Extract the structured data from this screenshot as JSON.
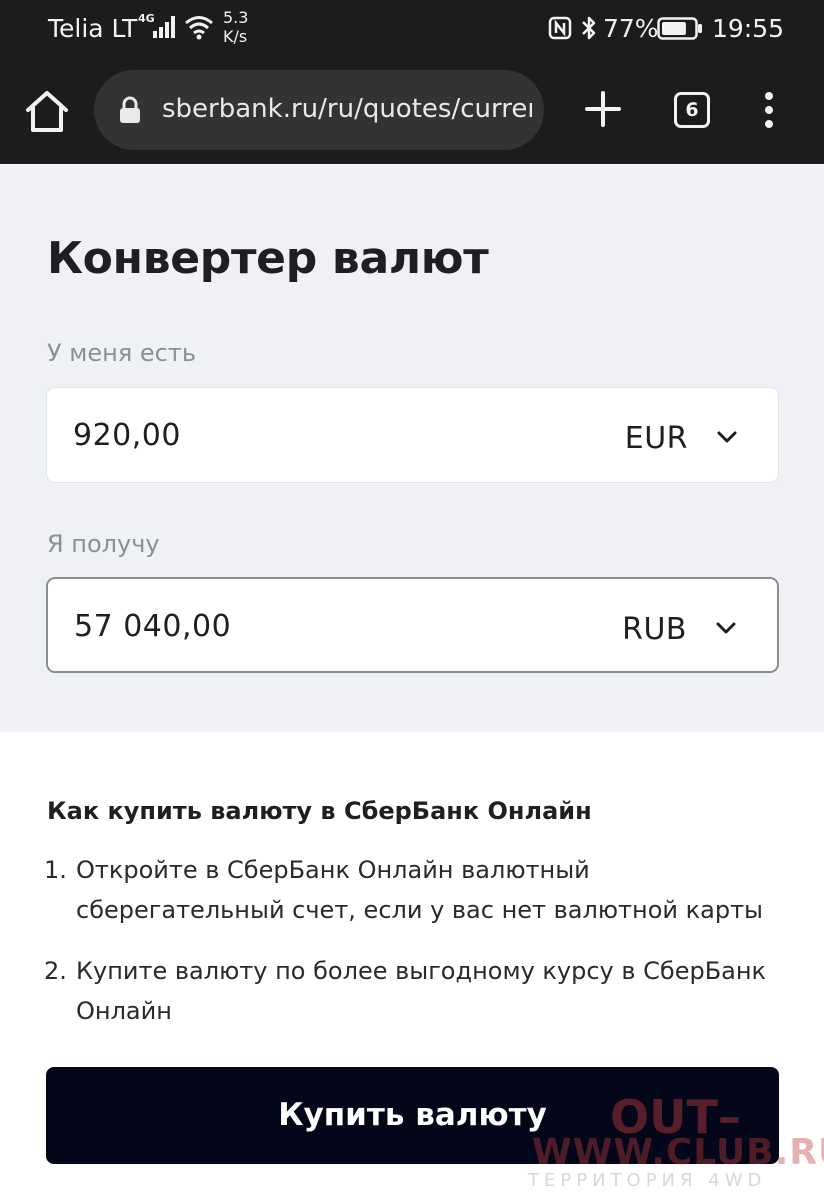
{
  "status_bar": {
    "carrier": "Telia LT",
    "network": "4G",
    "speed_value": "5.3",
    "speed_unit": "K/s",
    "battery_pct": "77%",
    "battery_level": 0.77,
    "time": "19:55"
  },
  "browser": {
    "url": "sberbank.ru/ru/quotes/currencyconverter",
    "tab_count": "6",
    "icons": [
      "home-icon",
      "lock-icon",
      "plus-icon",
      "tabs-icon",
      "kebab-menu-icon"
    ]
  },
  "converter": {
    "title": "Конвертер валют",
    "have_label": "У меня есть",
    "have_value": "920,00",
    "have_currency": "EUR",
    "get_label": "Я получу",
    "get_value": "57 040,00",
    "get_currency": "RUB"
  },
  "info": {
    "title": "Как купить валюту в СберБанк Онлайн",
    "steps": [
      {
        "num": "1.",
        "text": "Откройте в СберБанк Онлайн валютный сберегательный счет, если у вас нет валютной карты"
      },
      {
        "num": "2.",
        "text": "Купите валюту по более выгодному курсу в СберБанк Онлайн"
      }
    ],
    "buy_button": "Купить валюту"
  },
  "watermark": {
    "main": "OUT–",
    "url": "WWW.CLUB.RU",
    "sub": "ТЕРРИТОРИЯ 4WD"
  },
  "colors": {
    "browser_bg": "#1c1c1c",
    "url_bar_bg": "#333334",
    "converter_bg": "#eff1f5",
    "button_bg": "#04071a",
    "label_gray": "#8c9096"
  }
}
